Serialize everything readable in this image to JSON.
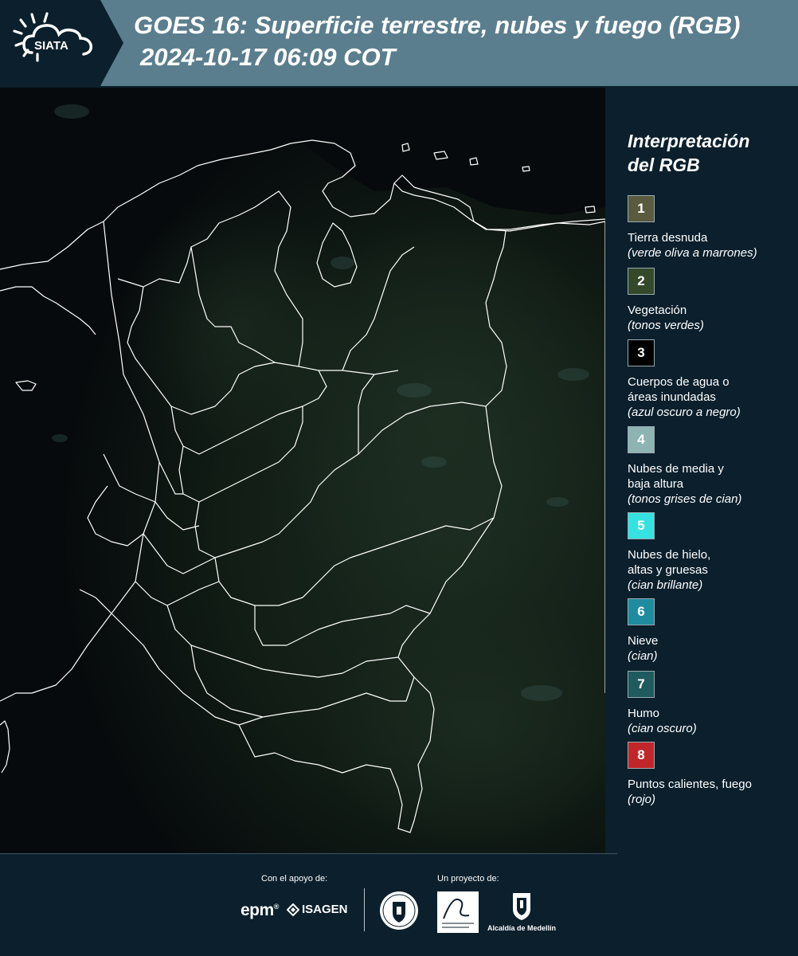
{
  "header": {
    "title": "GOES 16: Superficie terrestre, nubes y fuego (RGB)",
    "datetime": "2024-10-17 06:09 COT",
    "logo_text": "SIATA",
    "bar_color": "#5b7e8e",
    "logo_bg_color": "#0b1f2c"
  },
  "map": {
    "background_color": "#060a0c",
    "border_line_color": "#ffffff"
  },
  "legend": {
    "title": "Interpretación\ndel RGB",
    "items": [
      {
        "num": "1",
        "label": "Tierra desnuda",
        "desc": "(verde oliva a marrones)",
        "color": "#5a5a3e"
      },
      {
        "num": "2",
        "label": "Vegetación",
        "desc": "(tonos verdes)",
        "color": "#33492a"
      },
      {
        "num": "3",
        "label": "Cuerpos de agua o\náreas inundadas",
        "desc": "(azul oscuro a negro)",
        "color": "#000000"
      },
      {
        "num": "4",
        "label": "Nubes de media y\nbaja altura",
        "desc": "(tonos grises de cian)",
        "color": "#8db4b3"
      },
      {
        "num": "5",
        "label": "Nubes de hielo,\naltas y gruesas",
        "desc": "(cian brillante)",
        "color": "#36e1e1"
      },
      {
        "num": "6",
        "label": "Nieve",
        "desc": "(cian)",
        "color": "#1e8b9f"
      },
      {
        "num": "7",
        "label": "Humo",
        "desc": "(cian oscuro)",
        "color": "#1f5a5e"
      },
      {
        "num": "8",
        "label": "Puntos calientes, fuego",
        "desc": "(rojo)",
        "color": "#c1262a"
      }
    ]
  },
  "footer": {
    "support_label": "Con el apoyo de:",
    "project_label": "Un proyecto de:",
    "epm": "epm",
    "epm_mark": "®",
    "isagen": "ISAGEN",
    "alcaldia": "Alcaldía de Medellín"
  }
}
